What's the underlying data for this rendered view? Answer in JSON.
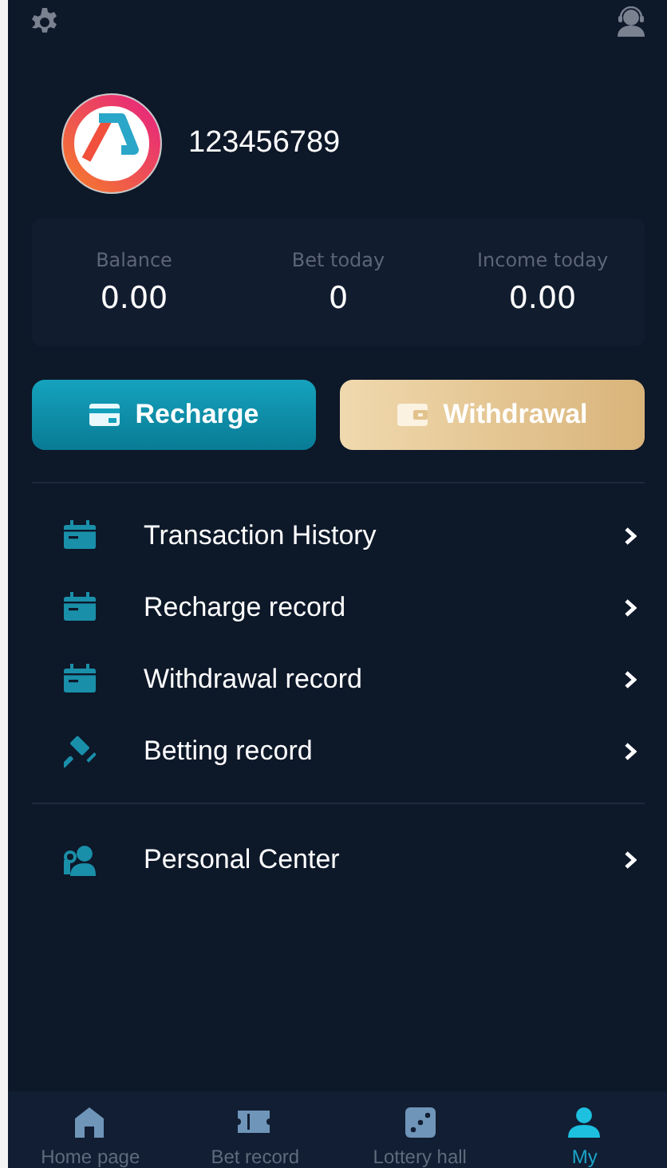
{
  "profile": {
    "username": "123456789"
  },
  "stats": [
    {
      "label": "Balance",
      "value": "0.00"
    },
    {
      "label": "Bet today",
      "value": "0"
    },
    {
      "label": "Income today",
      "value": "0.00"
    }
  ],
  "actions": [
    {
      "kind": "recharge",
      "label": "Recharge"
    },
    {
      "kind": "withdraw",
      "label": "Withdrawal"
    }
  ],
  "menu_groups": [
    [
      {
        "kind": "calendar",
        "label": "Transaction History"
      },
      {
        "kind": "calendar",
        "label": "Recharge record"
      },
      {
        "kind": "calendar",
        "label": "Withdrawal record"
      },
      {
        "kind": "gavel",
        "label": "Betting record"
      }
    ],
    [
      {
        "kind": "person",
        "label": "Personal Center"
      }
    ]
  ],
  "tabbar": [
    {
      "kind": "home",
      "label": "Home page",
      "selected": false
    },
    {
      "kind": "ticket",
      "label": "Bet record",
      "selected": false
    },
    {
      "kind": "dice",
      "label": "Lottery hall",
      "selected": false
    },
    {
      "kind": "user",
      "label": "My",
      "selected": true
    }
  ]
}
